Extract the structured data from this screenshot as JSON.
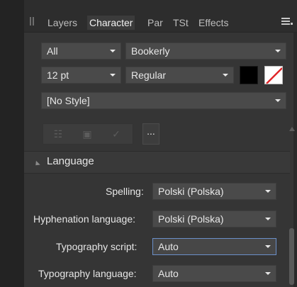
{
  "tabs": [
    {
      "label": "Layers",
      "active": false
    },
    {
      "label": "Character",
      "active": true
    },
    {
      "label": "Par",
      "active": false
    },
    {
      "label": "TSt",
      "active": false
    },
    {
      "label": "Effects",
      "active": false
    }
  ],
  "character": {
    "scope": "All",
    "font_family": "Bookerly",
    "font_size": "12 pt",
    "font_style": "Regular",
    "text_style": "[No Style]",
    "fill_color": "#000000",
    "stroke_color": "none",
    "more_label": "..."
  },
  "language": {
    "title": "Language",
    "spelling_label": "Spelling:",
    "spelling_value": "Polski (Polska)",
    "hyphenation_label": "Hyphenation language:",
    "hyphenation_value": "Polski (Polska)",
    "typo_script_label": "Typography script:",
    "typo_script_value": "Auto",
    "typo_language_label": "Typography language:",
    "typo_language_value": "Auto"
  },
  "colors": {
    "panel_bg": "#353535",
    "field_bg": "#4a4a4a",
    "focus_border": "#6a8fc8"
  }
}
